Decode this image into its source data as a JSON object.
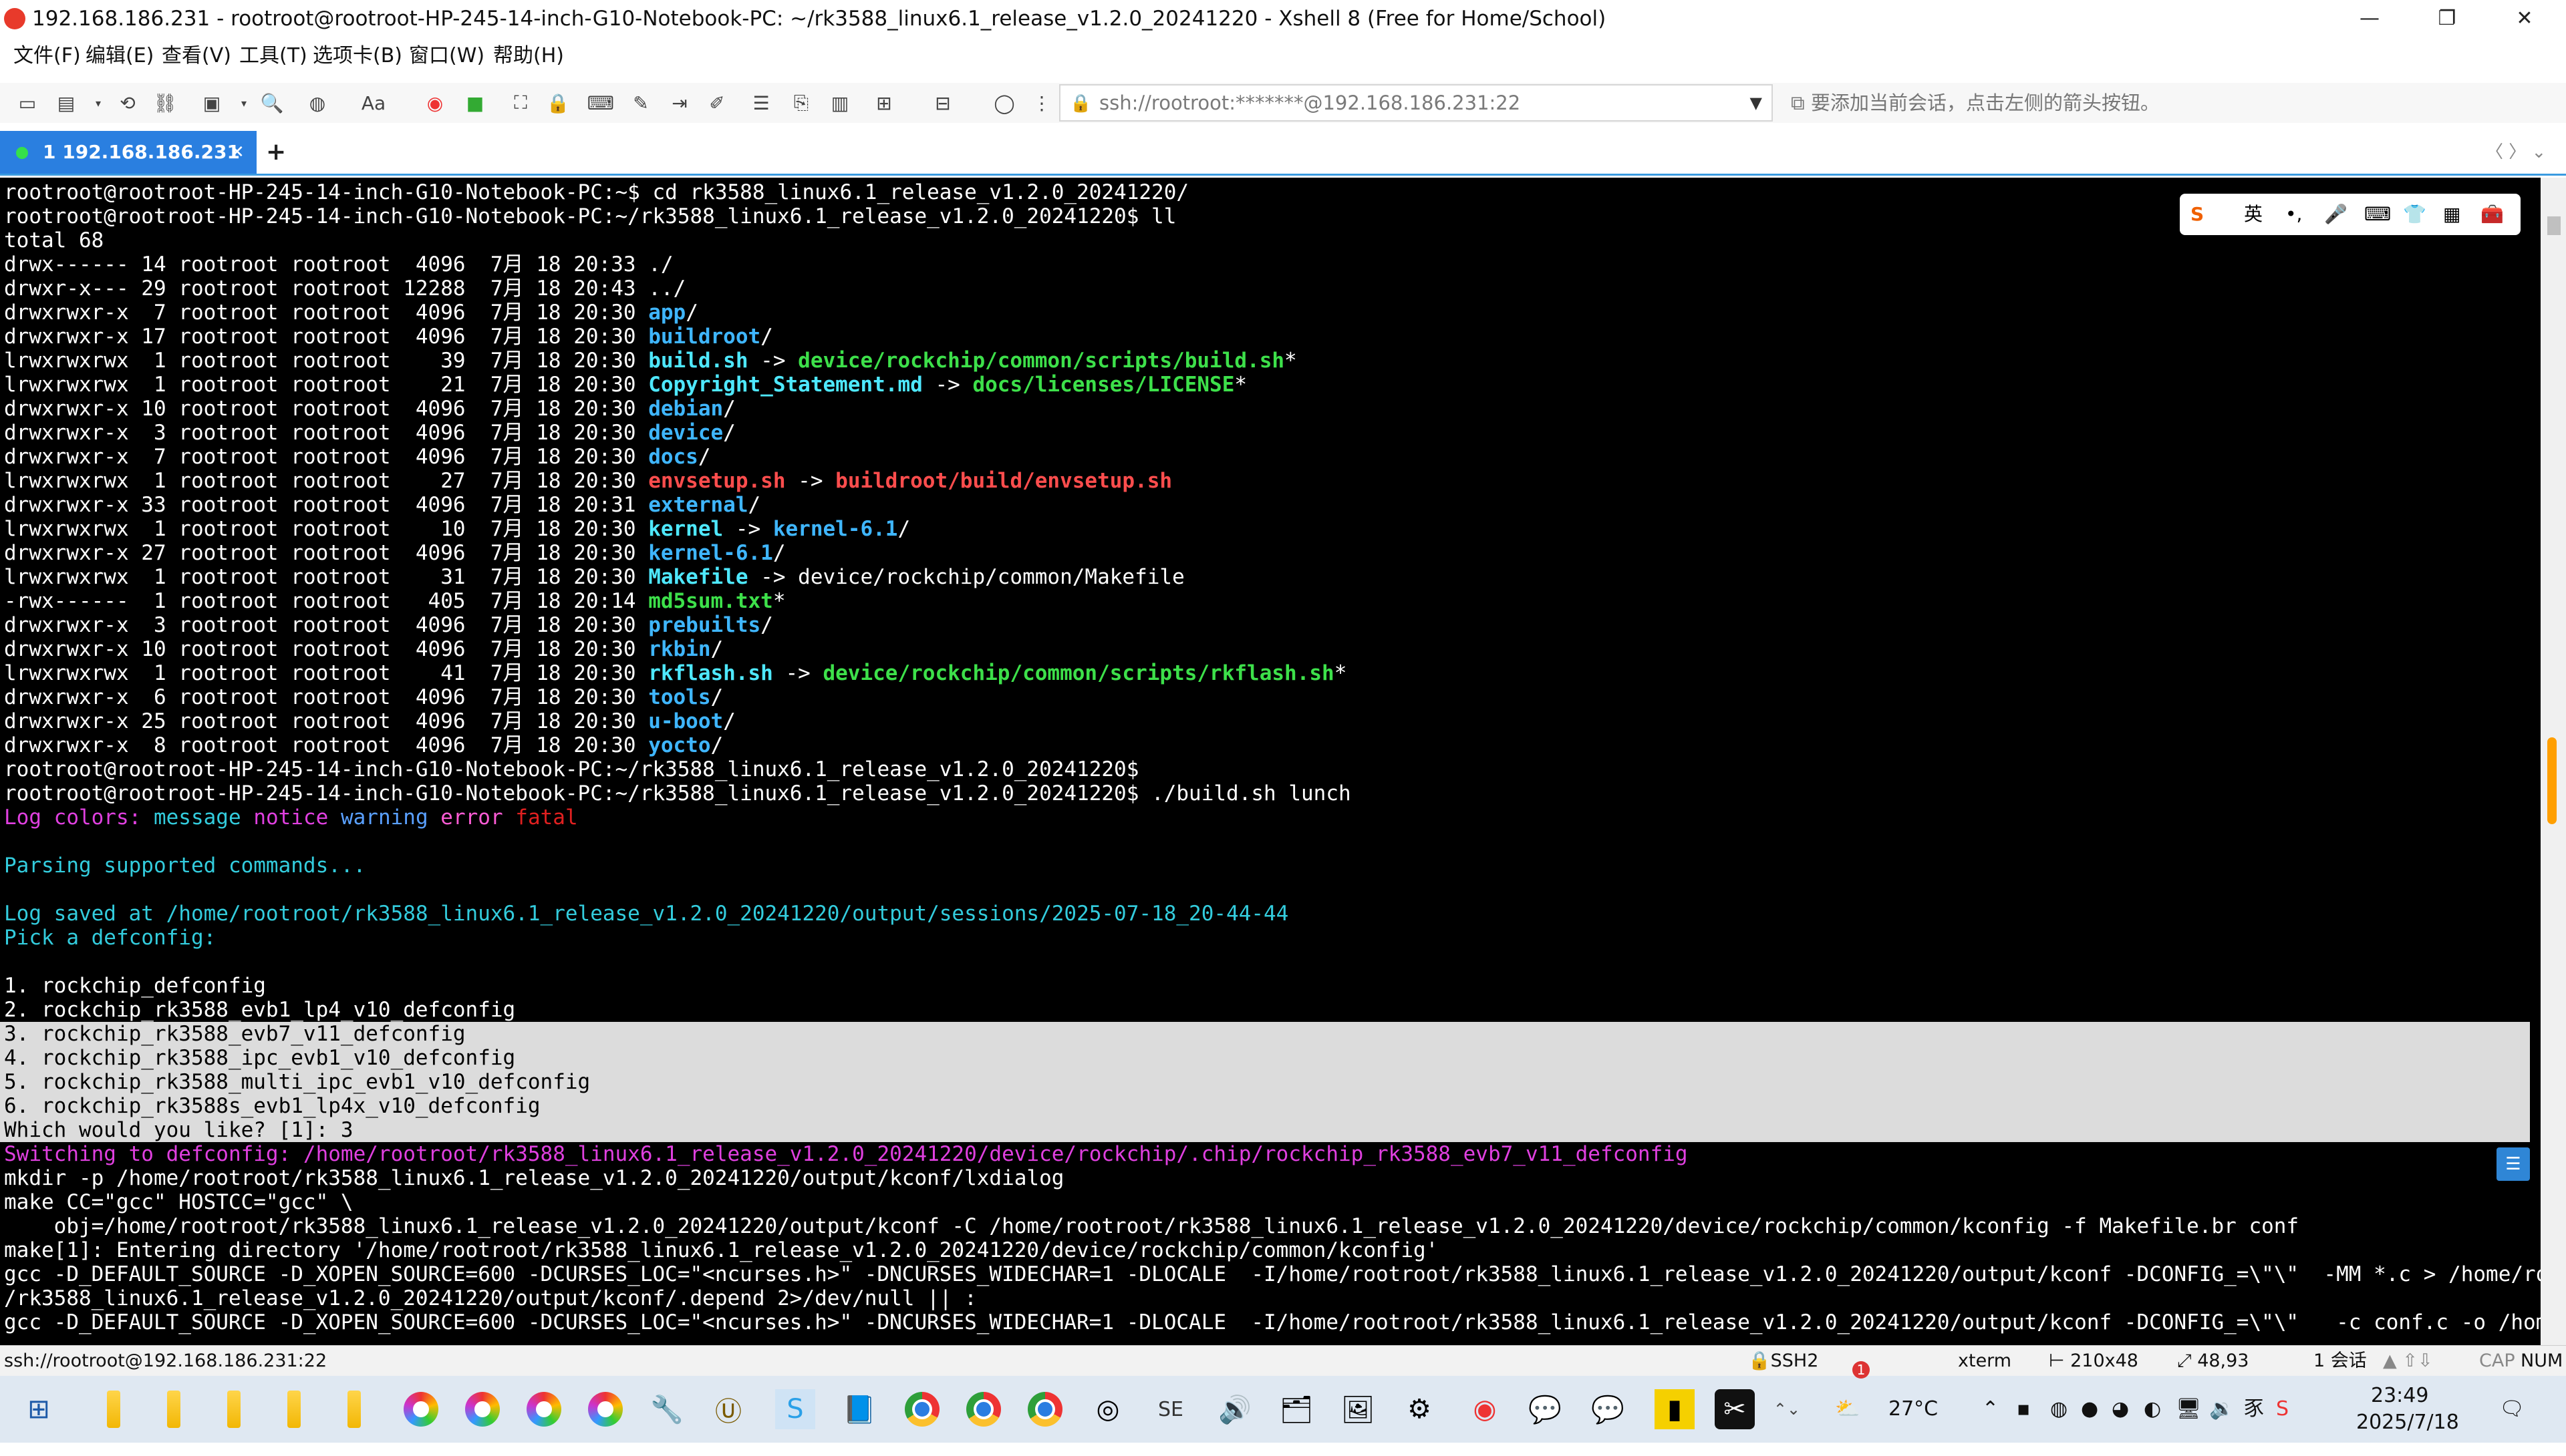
{
  "window": {
    "title": "192.168.186.231 - rootroot@rootroot-HP-245-14-inch-G10-Notebook-PC: ~/rk3588_linux6.1_release_v1.2.0_20241220 - Xshell 8 (Free for Home/School)",
    "minimize": "—",
    "maximize": "❐",
    "close": "✕"
  },
  "menu": [
    "文件(F)",
    "编辑(E)",
    "查看(V)",
    "工具(T)",
    "选项卡(B)",
    "窗口(W)",
    "帮助(H)"
  ],
  "toolbar": {
    "address": "ssh://rootroot:*******@192.168.186.231:22",
    "hint": "要添加当前会话，点击左侧的箭头按钮。"
  },
  "tabs": {
    "active_label": "1 192.168.186.231",
    "close": "✕",
    "add": "+",
    "nav": "〈 〉 ⌄"
  },
  "ime": {
    "logo": "S",
    "lang": "英",
    "dot": "•,",
    "mic": "🎤",
    "kbd": "⌨",
    "skin": "👕",
    "grid": "▦",
    "tool": "🧰"
  },
  "terminal": {
    "prompt_home": "rootroot@rootroot-HP-245-14-inch-G10-Notebook-PC:~$",
    "prompt_dir": "rootroot@rootroot-HP-245-14-inch-G10-Notebook-PC:~/rk3588_linux6.1_release_v1.2.0_20241220$",
    "cmd_cd": " cd rk3588_linux6.1_release_v1.2.0_20241220/",
    "cmd_ll": " ll",
    "cmd_build": " ./build.sh lunch",
    "total": "total 68",
    "listing": [
      {
        "meta": "drwx------ 14 rootroot rootroot  4096  7月 18 20:33 ",
        "name": "./",
        "cls": "c-y",
        "arrow": "",
        "target": "",
        "tcls": ""
      },
      {
        "meta": "drwxr-x--- 29 rootroot rootroot 12288  7月 18 20:43 ",
        "name": "../",
        "cls": "c-y",
        "arrow": "",
        "target": "",
        "tcls": ""
      },
      {
        "meta": "drwxrwxr-x  7 rootroot rootroot  4096  7月 18 20:30 ",
        "name": "app",
        "cls": "c-cyan",
        "arrow": "/",
        "target": "",
        "tcls": ""
      },
      {
        "meta": "drwxrwxr-x 17 rootroot rootroot  4096  7月 18 20:30 ",
        "name": "buildroot",
        "cls": "c-cyan",
        "arrow": "/",
        "target": "",
        "tcls": ""
      },
      {
        "meta": "lrwxrwxrwx  1 rootroot rootroot    39  7月 18 20:30 ",
        "name": "build.sh",
        "cls": "c-bcyan",
        "arrow": " -> ",
        "target": "device/rockchip/common/scripts/build.sh",
        "tcls": "c-green",
        "suffix": "*"
      },
      {
        "meta": "lrwxrwxrwx  1 rootroot rootroot    21  7月 18 20:30 ",
        "name": "Copyright_Statement.md",
        "cls": "c-bcyan",
        "arrow": " -> ",
        "target": "docs/licenses/LICENSE",
        "tcls": "c-green",
        "suffix": "*"
      },
      {
        "meta": "drwxrwxr-x 10 rootroot rootroot  4096  7月 18 20:30 ",
        "name": "debian",
        "cls": "c-cyan",
        "arrow": "/",
        "target": "",
        "tcls": ""
      },
      {
        "meta": "drwxrwxr-x  3 rootroot rootroot  4096  7月 18 20:30 ",
        "name": "device",
        "cls": "c-cyan",
        "arrow": "/",
        "target": "",
        "tcls": ""
      },
      {
        "meta": "drwxrwxr-x  7 rootroot rootroot  4096  7月 18 20:30 ",
        "name": "docs",
        "cls": "c-cyan",
        "arrow": "/",
        "target": "",
        "tcls": ""
      },
      {
        "meta": "lrwxrwxrwx  1 rootroot rootroot    27  7月 18 20:30 ",
        "name": "envsetup.sh",
        "cls": "c-red",
        "arrow": " -> ",
        "target": "buildroot/build/envsetup.sh",
        "tcls": "c-red",
        "suffix": ""
      },
      {
        "meta": "drwxrwxr-x 33 rootroot rootroot  4096  7月 18 20:31 ",
        "name": "external",
        "cls": "c-cyan",
        "arrow": "/",
        "target": "",
        "tcls": ""
      },
      {
        "meta": "lrwxrwxrwx  1 rootroot rootroot    10  7月 18 20:30 ",
        "name": "kernel",
        "cls": "c-bcyan",
        "arrow": " -> ",
        "target": "kernel-6.1",
        "tcls": "c-cyan",
        "suffix": "/"
      },
      {
        "meta": "drwxrwxr-x 27 rootroot rootroot  4096  7月 18 20:30 ",
        "name": "kernel-6.1",
        "cls": "c-cyan",
        "arrow": "/",
        "target": "",
        "tcls": ""
      },
      {
        "meta": "lrwxrwxrwx  1 rootroot rootroot    31  7月 18 20:30 ",
        "name": "Makefile",
        "cls": "c-bcyan",
        "arrow": " -> ",
        "target": "device/rockchip/common/Makefile",
        "tcls": "c-y",
        "suffix": ""
      },
      {
        "meta": "-rwx------  1 rootroot rootroot   405  7月 18 20:14 ",
        "name": "md5sum.txt",
        "cls": "c-green",
        "arrow": "*",
        "target": "",
        "tcls": ""
      },
      {
        "meta": "drwxrwxr-x  3 rootroot rootroot  4096  7月 18 20:30 ",
        "name": "prebuilts",
        "cls": "c-cyan",
        "arrow": "/",
        "target": "",
        "tcls": ""
      },
      {
        "meta": "drwxrwxr-x 10 rootroot rootroot  4096  7月 18 20:30 ",
        "name": "rkbin",
        "cls": "c-cyan",
        "arrow": "/",
        "target": "",
        "tcls": ""
      },
      {
        "meta": "lrwxrwxrwx  1 rootroot rootroot    41  7月 18 20:30 ",
        "name": "rkflash.sh",
        "cls": "c-bcyan",
        "arrow": " -> ",
        "target": "device/rockchip/common/scripts/rkflash.sh",
        "tcls": "c-green",
        "suffix": "*"
      },
      {
        "meta": "drwxrwxr-x  6 rootroot rootroot  4096  7月 18 20:30 ",
        "name": "tools",
        "cls": "c-cyan",
        "arrow": "/",
        "target": "",
        "tcls": ""
      },
      {
        "meta": "drwxrwxr-x 25 rootroot rootroot  4096  7月 18 20:30 ",
        "name": "u-boot",
        "cls": "c-cyan",
        "arrow": "/",
        "target": "",
        "tcls": ""
      },
      {
        "meta": "drwxrwxr-x  8 rootroot rootroot  4096  7月 18 20:30 ",
        "name": "yocto",
        "cls": "c-cyan",
        "arrow": "/",
        "target": "",
        "tcls": ""
      }
    ],
    "log_colors": {
      "label": "Log colors:",
      "message": "message",
      "notice": "notice",
      "warning": "warning",
      "error": "error",
      "fatal": "fatal"
    },
    "parsing": "Parsing supported commands...",
    "log_saved": "Log saved at /home/rootroot/rk3588_linux6.1_release_v1.2.0_20241220/output/sessions/2025-07-18_20-44-44",
    "pick": "Pick a defconfig:",
    "options": [
      "1. rockchip_defconfig",
      "2. rockchip_rk3588_evb1_lp4_v10_defconfig",
      "3. rockchip_rk3588_evb7_v11_defconfig",
      "4. rockchip_rk3588_ipc_evb1_v10_defconfig",
      "5. rockchip_rk3588_multi_ipc_evb1_v10_defconfig",
      "6. rockchip_rk3588s_evb1_lp4x_v10_defconfig"
    ],
    "question": "Which would you like? [1]: 3",
    "switching": "Switching to defconfig: /home/rootroot/rk3588_linux6.1_release_v1.2.0_20241220/device/rockchip/.chip/rockchip_rk3588_evb7_v11_defconfig",
    "out": [
      "mkdir -p /home/rootroot/rk3588_linux6.1_release_v1.2.0_20241220/output/kconf/lxdialog",
      "make CC=\"gcc\" HOSTCC=\"gcc\" \\",
      "    obj=/home/rootroot/rk3588_linux6.1_release_v1.2.0_20241220/output/kconf -C /home/rootroot/rk3588_linux6.1_release_v1.2.0_20241220/device/rockchip/common/kconfig -f Makefile.br conf",
      "make[1]: Entering directory '/home/rootroot/rk3588_linux6.1_release_v1.2.0_20241220/device/rockchip/common/kconfig'",
      "gcc -D_DEFAULT_SOURCE -D_XOPEN_SOURCE=600 -DCURSES_LOC=\"<ncurses.h>\" -DNCURSES_WIDECHAR=1 -DLOCALE  -I/home/rootroot/rk3588_linux6.1_release_v1.2.0_20241220/output/kconf -DCONFIG_=\\\"\\\"  -MM *.c > /home/rootroot",
      "/rk3588_linux6.1_release_v1.2.0_20241220/output/kconf/.depend 2>/dev/null || :",
      "gcc -D_DEFAULT_SOURCE -D_XOPEN_SOURCE=600 -DCURSES_LOC=\"<ncurses.h>\" -DNCURSES_WIDECHAR=1 -DLOCALE  -I/home/rootroot/rk3588_linux6.1_release_v1.2.0_20241220/output/kconf -DCONFIG_=\\\"\\\"   -c conf.c -o /home/root"
    ]
  },
  "status": {
    "addr": "ssh://rootroot@192.168.186.231:22",
    "proto": "SSH2",
    "term": "xterm",
    "size": "210x48",
    "pos": "48,93",
    "sessions": "1 会话",
    "cap": "CAP",
    "num": "NUM"
  },
  "taskbar": {
    "weather": "27°C",
    "badge": "1",
    "time": "23:49",
    "date": "2025/7/18"
  }
}
